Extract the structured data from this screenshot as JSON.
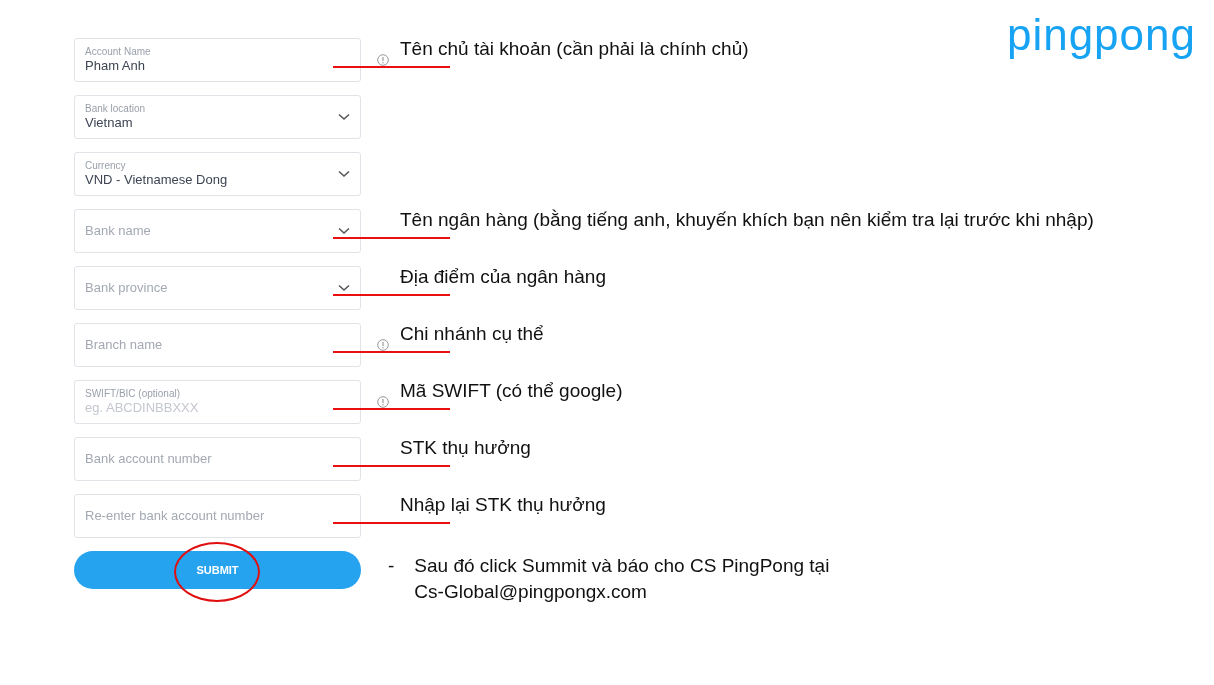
{
  "logo": "pingpong",
  "fields": [
    {
      "kind": "text",
      "label": "Account Name",
      "value": "Pham Anh",
      "info": true,
      "annotation": "Tên chủ tài khoản (cần phải là chính chủ)"
    },
    {
      "kind": "select",
      "label": "Bank location",
      "value": "Vietnam",
      "info": false
    },
    {
      "kind": "select",
      "label": "Currency",
      "value": "VND - Vietnamese Dong",
      "info": false
    },
    {
      "kind": "select",
      "placeholder": "Bank name",
      "info": false,
      "annotation": "Tên ngân hàng (bằng tiếng anh, khuyến khích bạn nên kiểm tra lại trước khi nhập)"
    },
    {
      "kind": "select",
      "placeholder": "Bank province",
      "info": false,
      "annotation": "Địa điểm của ngân hàng"
    },
    {
      "kind": "text",
      "placeholder": "Branch name",
      "info": true,
      "annotation": "Chi nhánh cụ thể"
    },
    {
      "kind": "text",
      "label": "SWIFT/BIC (optional)",
      "placeholder": "eg. ABCDINBBXXX",
      "info": true,
      "annotation": "Mã SWIFT (có thể google)"
    },
    {
      "kind": "text",
      "placeholder": "Bank account number",
      "info": false,
      "annotation": "STK thụ hưởng"
    },
    {
      "kind": "text",
      "placeholder": "Re-enter bank account number",
      "info": false,
      "annotation": "Nhập lại STK thụ hưởng"
    }
  ],
  "submit": {
    "label": "SUBMIT",
    "circled": true
  },
  "note": {
    "bullet": "-",
    "lines": [
      "Sau đó click Summit và báo cho CS PingPong tại",
      "Cs-Global@pingpongx.com"
    ]
  }
}
